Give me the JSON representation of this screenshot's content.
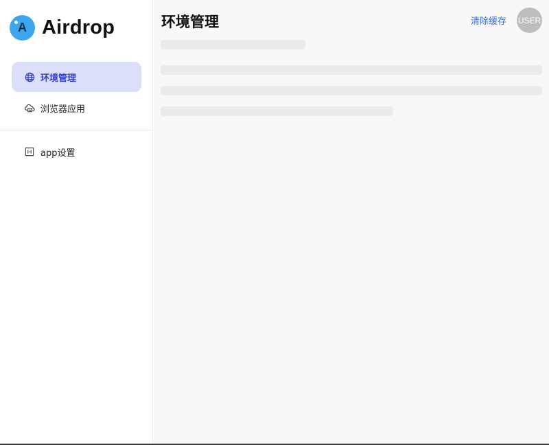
{
  "brand": {
    "name": "Airdrop",
    "logo_letter": "A",
    "accent": "#3ea6ef"
  },
  "sidebar": {
    "items": [
      {
        "label": "环境管理",
        "icon": "globe-icon",
        "active": true
      },
      {
        "label": "浏览器应用",
        "icon": "cloud-printer-icon",
        "active": false
      },
      {
        "label": "app设置",
        "icon": "panel-icon",
        "active": false
      }
    ],
    "active_bg": "#dcdff9",
    "active_color": "#2f3fc9"
  },
  "header": {
    "title": "环境管理",
    "clear_cache_label": "清除缓存",
    "avatar_label": "USER"
  },
  "main": {
    "loading": true
  }
}
